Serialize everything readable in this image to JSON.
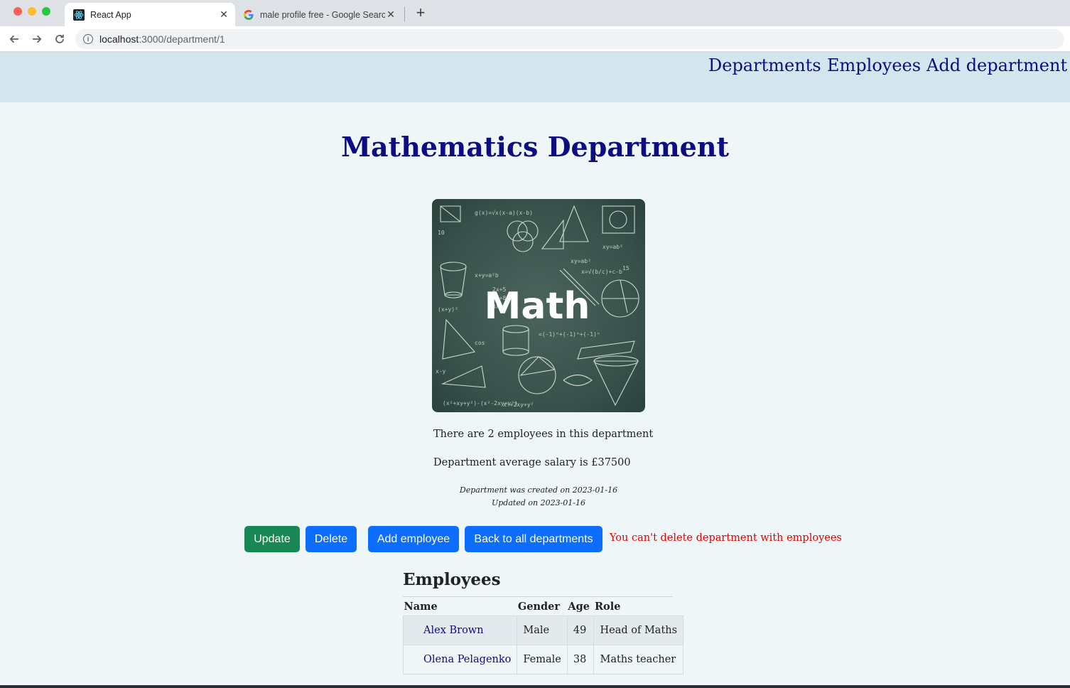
{
  "browser": {
    "tabs": [
      {
        "title": "React App",
        "active": true,
        "favicon": "react-icon"
      },
      {
        "title": "male profile free - Google Search",
        "active": false,
        "favicon": "google-icon"
      }
    ],
    "url_host": "localhost",
    "url_path": ":3000/department/1"
  },
  "nav": {
    "departments": "Departments",
    "employees": "Employees",
    "add_department": "Add department"
  },
  "department": {
    "title": "Mathematics Department",
    "image_text": "Math",
    "employee_count_text": "There are 2 employees in this department",
    "avg_salary_text": "Department average salary is £37500",
    "created_text": "Department was created on 2023-01-16",
    "updated_text": "Updated on 2023-01-16"
  },
  "actions": {
    "update": "Update",
    "delete": "Delete",
    "add_employee": "Add employee",
    "back": "Back to all departments",
    "error": "You can't delete department with employees"
  },
  "employees": {
    "heading": "Employees",
    "columns": [
      "Name",
      "Gender",
      "Age",
      "Role"
    ],
    "rows": [
      {
        "name": "Alex Brown",
        "gender": "Male",
        "age": "49",
        "role": "Head of Maths"
      },
      {
        "name": "Olena Pelagenko",
        "gender": "Female",
        "age": "38",
        "role": "Maths teacher"
      }
    ]
  },
  "colors": {
    "nav_bg": "#d5e5ee",
    "page_bg": "#eef6f8",
    "link": "#0d0d82",
    "update_button": "#198754",
    "primary_button": "#0d6efd",
    "error": "#e60000"
  }
}
